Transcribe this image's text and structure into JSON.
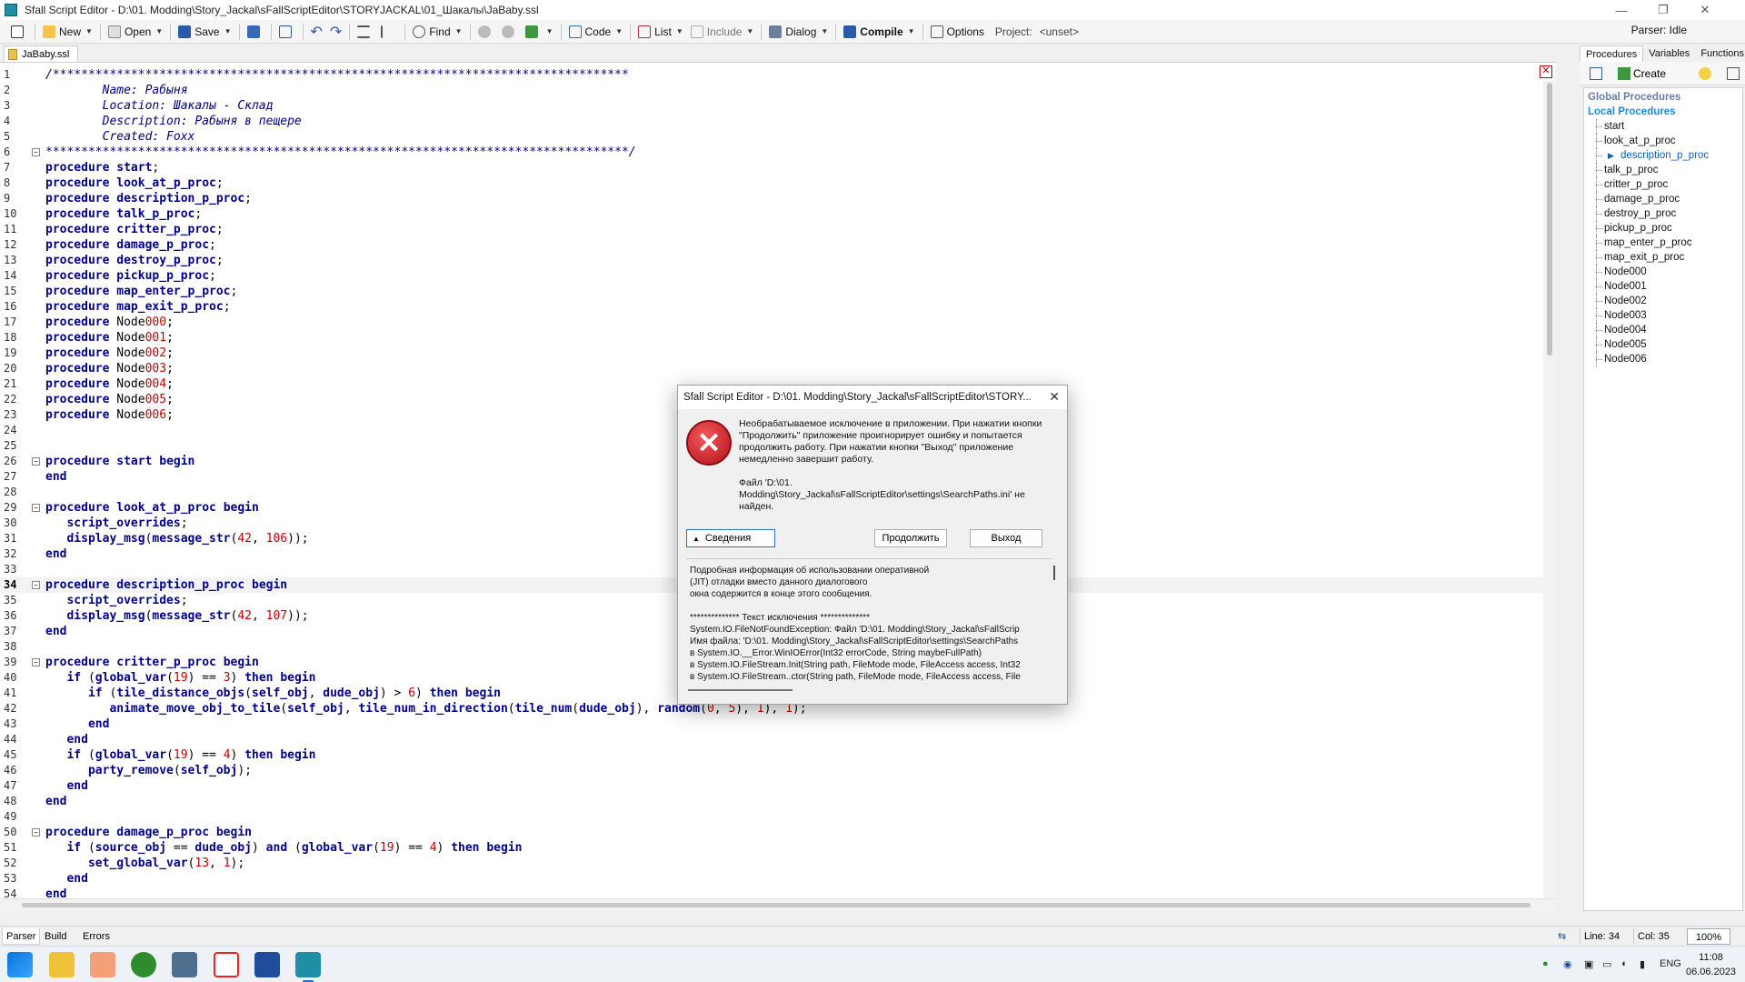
{
  "window": {
    "title": "Sfall Script Editor - D:\\01. Modding\\Story_Jackal\\sFallScriptEditor\\STORYJACKAL\\01_Шакалы\\JaBaby.ssl",
    "minimize": "—",
    "restore": "❐",
    "close": "✕"
  },
  "toolbar": {
    "new": "New",
    "open": "Open",
    "save": "Save",
    "find": "Find",
    "code": "Code",
    "list": "List",
    "include": "Include",
    "dialog": "Dialog",
    "compile": "Compile",
    "options": "Options",
    "project_label": "Project:",
    "project_value": "<unset>",
    "parser_status": "Parser: Idle"
  },
  "doc_tab": "JaBaby.ssl",
  "editor": {
    "close": "✕",
    "lines": [
      {
        "n": "1",
        "t": "/*********************************************************************************"
      },
      {
        "n": "2",
        "t": "        Name: Рабыня"
      },
      {
        "n": "3",
        "t": "        Location: Шакалы - Склад"
      },
      {
        "n": "4",
        "t": "        Description: Рабыня в пещере"
      },
      {
        "n": "5",
        "t": "        Created: Foxx"
      },
      {
        "n": "6",
        "t": "**********************************************************************************/"
      },
      {
        "n": "7",
        "t": "procedure start;"
      },
      {
        "n": "8",
        "t": "procedure look_at_p_proc;"
      },
      {
        "n": "9",
        "t": "procedure description_p_proc;"
      },
      {
        "n": "10",
        "t": "procedure talk_p_proc;"
      },
      {
        "n": "11",
        "t": "procedure critter_p_proc;"
      },
      {
        "n": "12",
        "t": "procedure damage_p_proc;"
      },
      {
        "n": "13",
        "t": "procedure destroy_p_proc;"
      },
      {
        "n": "14",
        "t": "procedure pickup_p_proc;"
      },
      {
        "n": "15",
        "t": "procedure map_enter_p_proc;"
      },
      {
        "n": "16",
        "t": "procedure map_exit_p_proc;"
      },
      {
        "n": "17",
        "t": "procedure Node000;"
      },
      {
        "n": "18",
        "t": "procedure Node001;"
      },
      {
        "n": "19",
        "t": "procedure Node002;"
      },
      {
        "n": "20",
        "t": "procedure Node003;"
      },
      {
        "n": "21",
        "t": "procedure Node004;"
      },
      {
        "n": "22",
        "t": "procedure Node005;"
      },
      {
        "n": "23",
        "t": "procedure Node006;"
      },
      {
        "n": "24",
        "t": ""
      },
      {
        "n": "25",
        "t": ""
      },
      {
        "n": "26",
        "t": "procedure start begin"
      },
      {
        "n": "27",
        "t": "end"
      },
      {
        "n": "28",
        "t": ""
      },
      {
        "n": "29",
        "t": "procedure look_at_p_proc begin"
      },
      {
        "n": "30",
        "t": "   script_overrides;"
      },
      {
        "n": "31",
        "t": "   display_msg(message_str(42, 106));"
      },
      {
        "n": "32",
        "t": "end"
      },
      {
        "n": "33",
        "t": ""
      },
      {
        "n": "34",
        "t": "procedure description_p_proc begin"
      },
      {
        "n": "35",
        "t": "   script_overrides;"
      },
      {
        "n": "36",
        "t": "   display_msg(message_str(42, 107));"
      },
      {
        "n": "37",
        "t": "end"
      },
      {
        "n": "38",
        "t": ""
      },
      {
        "n": "39",
        "t": "procedure critter_p_proc begin"
      },
      {
        "n": "40",
        "t": "   if (global_var(19) == 3) then begin"
      },
      {
        "n": "41",
        "t": "      if (tile_distance_objs(self_obj, dude_obj) > 6) then begin"
      },
      {
        "n": "42",
        "t": "         animate_move_obj_to_tile(self_obj, tile_num_in_direction(tile_num(dude_obj), random(0, 5), 1), 1);"
      },
      {
        "n": "43",
        "t": "      end"
      },
      {
        "n": "44",
        "t": "   end"
      },
      {
        "n": "45",
        "t": "   if (global_var(19) == 4) then begin"
      },
      {
        "n": "46",
        "t": "      party_remove(self_obj);"
      },
      {
        "n": "47",
        "t": "   end"
      },
      {
        "n": "48",
        "t": "end"
      },
      {
        "n": "49",
        "t": ""
      },
      {
        "n": "50",
        "t": "procedure damage_p_proc begin"
      },
      {
        "n": "51",
        "t": "   if (source_obj == dude_obj) and (global_var(19) == 4) then begin"
      },
      {
        "n": "52",
        "t": "      set_global_var(13, 1);"
      },
      {
        "n": "53",
        "t": "   end"
      },
      {
        "n": "54",
        "t": "end"
      }
    ]
  },
  "right_panel": {
    "tabs": [
      "Procedures",
      "Variables",
      "Functions"
    ],
    "create": "Create",
    "global_header": "Global Procedures",
    "local_header": "Local Procedures",
    "items": [
      "start",
      "look_at_p_proc",
      "description_p_proc",
      "talk_p_proc",
      "critter_p_proc",
      "damage_p_proc",
      "destroy_p_proc",
      "pickup_p_proc",
      "map_enter_p_proc",
      "map_exit_p_proc",
      "Node000",
      "Node001",
      "Node002",
      "Node003",
      "Node004",
      "Node005",
      "Node006"
    ],
    "selected_index": 2
  },
  "statusbar": {
    "tabs": [
      "Parser",
      "Build",
      "Errors"
    ],
    "line": "Line: 34",
    "col": "Col: 35",
    "zoom": "100%"
  },
  "taskbar": {
    "lang": "ENG",
    "time": "11:08",
    "date": "06.06.2023"
  },
  "dialog": {
    "title": "Sfall Script Editor - D:\\01. Modding\\Story_Jackal\\sFallScriptEditor\\STORY...",
    "close": "✕",
    "message": "Необрабатываемое исключение в приложении. При нажатии кнопки \"Продолжить\" приложение проигнорирует ошибку и попытается продолжить работу. При нажатии кнопки \"Выход\" приложение немедленно завершит работу.",
    "file_message": "Файл 'D:\\01. Modding\\Story_Jackal\\sFallScriptEditor\\settings\\SearchPaths.ini' не найден.",
    "details_button": "Сведения",
    "continue_button": "Продолжить",
    "exit_button": "Выход",
    "details_lines": [
      "Подробная информация об использовании оперативной",
      "(JIT) отладки вместо данного диалогового",
      "окна содержится в конце этого сообщения.",
      "",
      "************** Текст исключения **************",
      "System.IO.FileNotFoundException: Файл 'D:\\01. Modding\\Story_Jackal\\sFallScrip",
      "Имя файла: 'D:\\01. Modding\\Story_Jackal\\sFallScriptEditor\\settings\\SearchPaths",
      "   в System.IO.__Error.WinIOError(Int32 errorCode, String maybeFullPath)",
      "   в System.IO.FileStream.Init(String path, FileMode mode, FileAccess access, Int32",
      "   в System.IO.FileStream..ctor(String path, FileMode mode, FileAccess access, File"
    ]
  }
}
